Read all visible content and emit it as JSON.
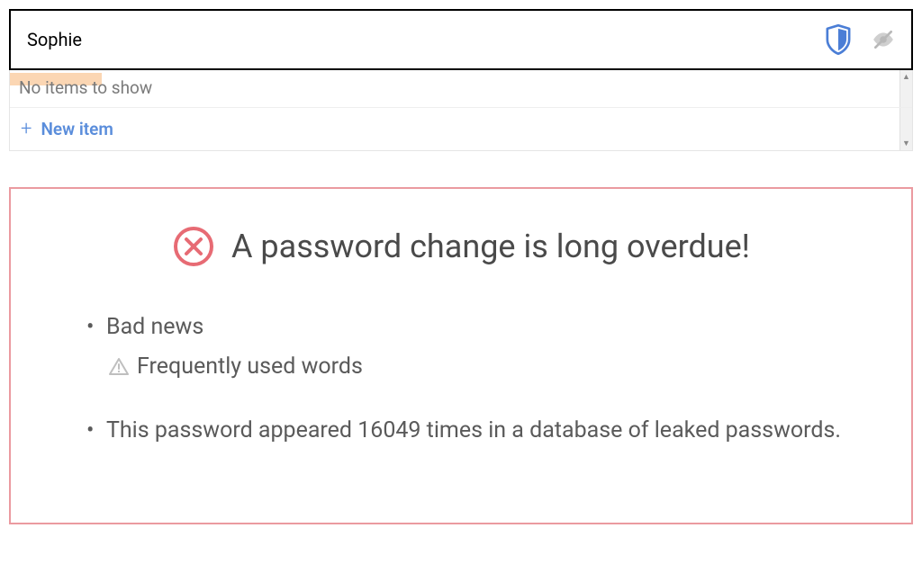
{
  "search": {
    "value": "Sophie"
  },
  "dropdown": {
    "no_items_text": "No items to show",
    "new_item_label": "New item"
  },
  "alert": {
    "title": "A password change is long overdue!",
    "items": [
      {
        "text": "Bad news",
        "sub": "Frequently used words"
      },
      {
        "text": "This password appeared 16049 times in a database of leaked passwords."
      }
    ]
  }
}
